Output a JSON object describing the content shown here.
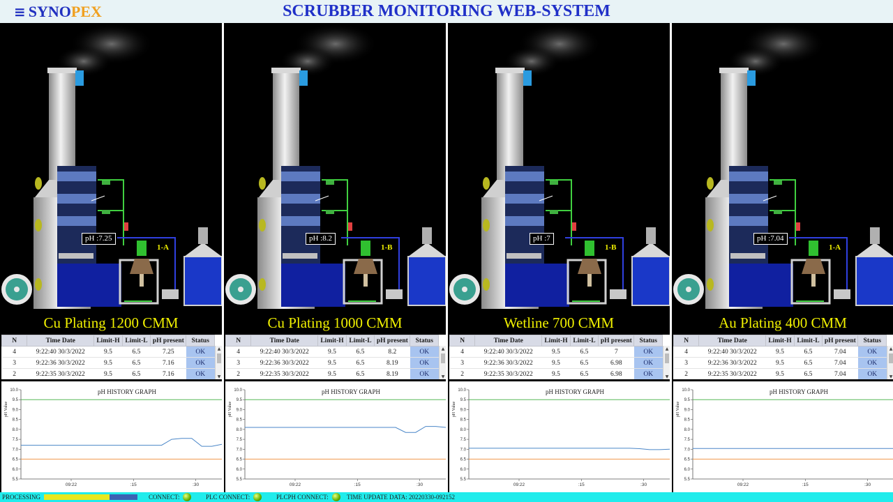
{
  "header": {
    "brand_a": "SYNO",
    "brand_b": "PEX",
    "title": "SCRUBBER MONITORING WEB-SYSTEM"
  },
  "columns": [
    "N",
    "Time Date",
    "Limit-H",
    "Limit-L",
    "pH present",
    "Status"
  ],
  "graph": {
    "title": "pH HISTORY GRAPH",
    "ylabel": "pH Value"
  },
  "panels": [
    {
      "name": "Cu Plating 1200 CMM",
      "ph_label": "pH :7.25",
      "unit": "1-A",
      "rows": [
        [
          "4",
          "9:22:40 30/3/2022",
          "9.5",
          "6.5",
          "7.25",
          "OK"
        ],
        [
          "3",
          "9:22:36 30/3/2022",
          "9.5",
          "6.5",
          "7.16",
          "OK"
        ],
        [
          "2",
          "9:22:35 30/3/2022",
          "9.5",
          "6.5",
          "7.16",
          "OK"
        ]
      ]
    },
    {
      "name": "Cu Plating 1000 CMM",
      "ph_label": "pH :8.2",
      "unit": "1-B",
      "rows": [
        [
          "4",
          "9:22:40 30/3/2022",
          "9.5",
          "6.5",
          "8.2",
          "OK"
        ],
        [
          "3",
          "9:22:36 30/3/2022",
          "9.5",
          "6.5",
          "8.19",
          "OK"
        ],
        [
          "2",
          "9:22:35 30/3/2022",
          "9.5",
          "6.5",
          "8.19",
          "OK"
        ]
      ]
    },
    {
      "name": "Wetline 700 CMM",
      "ph_label": "pH :7",
      "unit": "1-B",
      "rows": [
        [
          "4",
          "9:22:40 30/3/2022",
          "9.5",
          "6.5",
          "7",
          "OK"
        ],
        [
          "3",
          "9:22:36 30/3/2022",
          "9.5",
          "6.5",
          "6.98",
          "OK"
        ],
        [
          "2",
          "9:22:35 30/3/2022",
          "9.5",
          "6.5",
          "6.98",
          "OK"
        ]
      ]
    },
    {
      "name": "Au Plating 400 CMM",
      "ph_label": "pH :7.04",
      "unit": "1-A",
      "rows": [
        [
          "4",
          "9:22:40 30/3/2022",
          "9.5",
          "6.5",
          "7.04",
          "OK"
        ],
        [
          "3",
          "9:22:36 30/3/2022",
          "9.5",
          "6.5",
          "7.04",
          "OK"
        ],
        [
          "2",
          "9:22:35 30/3/2022",
          "9.5",
          "6.5",
          "7.04",
          "OK"
        ]
      ]
    }
  ],
  "chart_data": [
    {
      "type": "line",
      "title": "pH HISTORY GRAPH",
      "ylabel": "pH Value",
      "ylim": [
        5.5,
        10.0
      ],
      "yticks": [
        "10.0",
        "9.5",
        "9.0",
        "8.5",
        "8.0",
        "7.5",
        "7.0",
        "6.5",
        "6.0",
        "5.5"
      ],
      "xticks": [
        "09:22",
        ":15",
        ":30"
      ],
      "limit_high": 9.5,
      "limit_low": 6.5,
      "series": [
        {
          "values": [
            7.2,
            7.2,
            7.2,
            7.2,
            7.2,
            7.2,
            7.2,
            7.2,
            7.2,
            7.2,
            7.2,
            7.2,
            7.2,
            7.2,
            7.2,
            7.5,
            7.55,
            7.55,
            7.15,
            7.15,
            7.25
          ]
        }
      ],
      "colors": {
        "series": "#4a86c8",
        "high": "#3fae3f",
        "low": "#f08b36"
      }
    },
    {
      "type": "line",
      "title": "pH HISTORY GRAPH",
      "ylabel": "pH Value",
      "ylim": [
        5.5,
        10.0
      ],
      "yticks": [
        "10.0",
        "9.5",
        "9.0",
        "8.5",
        "8.0",
        "7.5",
        "7.0",
        "6.5",
        "6.0",
        "5.5"
      ],
      "xticks": [
        "09:22",
        ":15",
        ":30"
      ],
      "limit_high": 9.5,
      "limit_low": 6.5,
      "series": [
        {
          "values": [
            8.1,
            8.1,
            8.1,
            8.1,
            8.1,
            8.1,
            8.1,
            8.1,
            8.1,
            8.1,
            8.1,
            8.1,
            8.1,
            8.1,
            8.1,
            8.1,
            7.85,
            7.85,
            8.15,
            8.15,
            8.1
          ]
        }
      ],
      "colors": {
        "series": "#4a86c8",
        "high": "#3fae3f",
        "low": "#f08b36"
      }
    },
    {
      "type": "line",
      "title": "pH HISTORY GRAPH",
      "ylabel": "pH Value",
      "ylim": [
        5.5,
        10.0
      ],
      "yticks": [
        "10.0",
        "9.5",
        "9.0",
        "8.5",
        "8.0",
        "7.5",
        "7.0",
        "6.5",
        "6.0",
        "5.5"
      ],
      "xticks": [
        "09:22",
        ":15",
        ":30"
      ],
      "limit_high": 9.5,
      "limit_low": 6.5,
      "series": [
        {
          "values": [
            7.05,
            7.05,
            7.05,
            7.05,
            7.05,
            7.05,
            7.05,
            7.05,
            7.05,
            7.05,
            7.05,
            7.05,
            7.05,
            7.05,
            7.05,
            7.05,
            7.05,
            7.03,
            6.98,
            6.98,
            7.0
          ]
        }
      ],
      "colors": {
        "series": "#4a86c8",
        "high": "#3fae3f",
        "low": "#f08b36"
      }
    },
    {
      "type": "line",
      "title": "pH HISTORY GRAPH",
      "ylabel": "pH Value",
      "ylim": [
        5.5,
        10.0
      ],
      "yticks": [
        "10.0",
        "9.5",
        "9.0",
        "8.5",
        "8.0",
        "7.5",
        "7.0",
        "6.5",
        "6.0",
        "5.5"
      ],
      "xticks": [
        "09:22",
        ":15",
        ":30"
      ],
      "limit_high": 9.5,
      "limit_low": 6.5,
      "series": [
        {
          "values": [
            7.04,
            7.04,
            7.04,
            7.04,
            7.04,
            7.04,
            7.04,
            7.04,
            7.04,
            7.04,
            7.04,
            7.04,
            7.04,
            7.04,
            7.04,
            7.04,
            7.04,
            7.04,
            7.04,
            7.04,
            7.04
          ]
        }
      ],
      "colors": {
        "series": "#4a86c8",
        "high": "#3fae3f",
        "low": "#f08b36"
      }
    }
  ],
  "footer": {
    "processing_label": "PROCESSING",
    "processing_progress": 0.7,
    "connect_label": "CONNECT:",
    "plc_label": "PLC CONNECT:",
    "plcph_label": "PLCPH CONNECT:",
    "time_label": "TIME UPDATE DATA: 20220330-092152"
  }
}
